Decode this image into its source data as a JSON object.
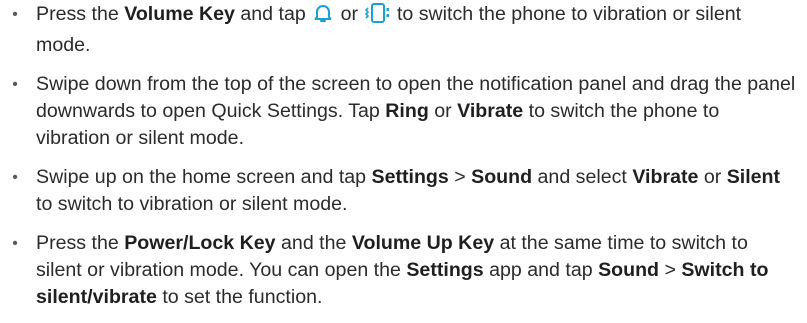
{
  "bullet_char": "•",
  "items": [
    {
      "parts": [
        "Press the ",
        "Volume Key",
        " and tap ",
        "bell-icon",
        " or ",
        "vibrate-icon",
        " to switch the phone to vibration or silent mode."
      ]
    },
    {
      "parts": [
        "Swipe down from the top of the screen to open the notification panel and drag the panel downwards to open Quick Settings. Tap ",
        "Ring",
        " or ",
        "Vibrate",
        " to switch the phone to vibration or silent mode."
      ]
    },
    {
      "parts": [
        "Swipe up on the home screen and tap ",
        "Settings",
        " > ",
        "Sound",
        " and select ",
        "Vibrate",
        " or ",
        "Silent",
        " to switch to vibration or silent mode."
      ]
    },
    {
      "parts": [
        "Press the ",
        "Power/Lock Key",
        " and the ",
        "Volume Up Key",
        " at the same time to switch to silent or vibration mode. You can open the ",
        "Settings",
        " app and tap ",
        "Sound",
        " > ",
        "Switch to silent/vibrate",
        " to set the function."
      ]
    }
  ],
  "icon_color": "#1a9fd6"
}
